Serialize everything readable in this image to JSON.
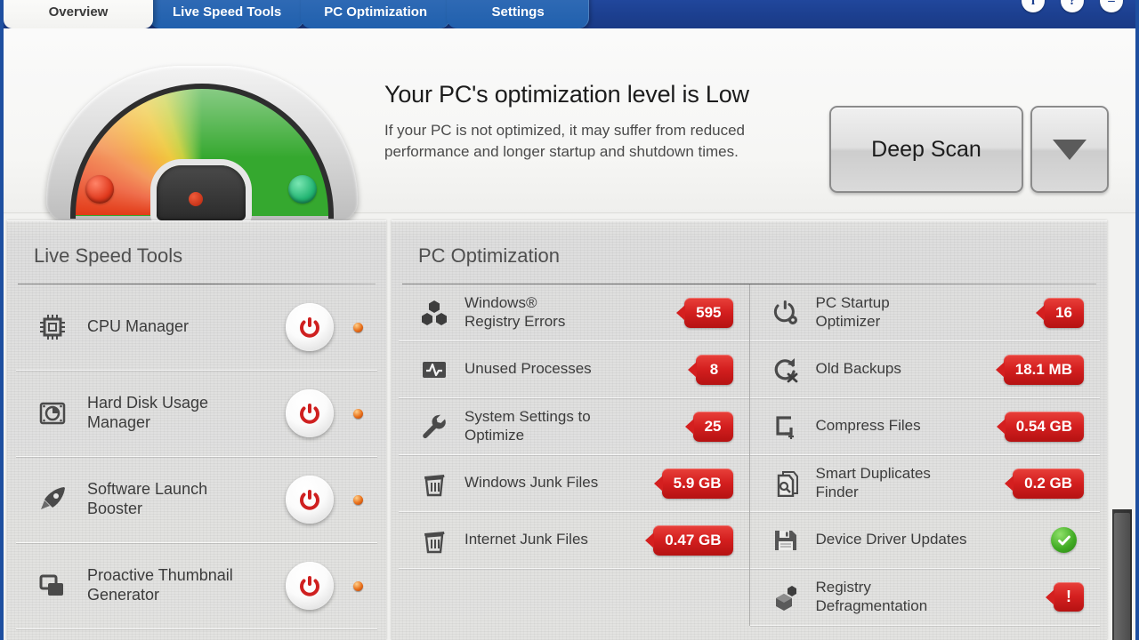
{
  "window": {
    "accent_blue": "#1e4fa0",
    "tab_blue": "#2f6ab5",
    "badge_red": "#d41f1f",
    "ok_green": "#3faa22"
  },
  "tabs": [
    {
      "label": "Overview",
      "active": true
    },
    {
      "label": "Live Speed Tools",
      "active": false
    },
    {
      "label": "PC Optimization",
      "active": false
    },
    {
      "label": "Settings",
      "active": false
    }
  ],
  "window_icons": [
    {
      "name": "info-icon",
      "glyph": "i"
    },
    {
      "name": "help-icon",
      "glyph": "?"
    },
    {
      "name": "minimize-icon",
      "glyph": "–"
    }
  ],
  "hero": {
    "title": "Your PC's optimization level is Low",
    "optimization_level": "Low",
    "description": "If your PC is not optimized, it may suffer from reduced performance and longer startup and shutdown times.",
    "scan_button": "Deep Scan",
    "scan_dropdown": "▼"
  },
  "live_speed_tools": {
    "title": "Live Speed Tools",
    "items": [
      {
        "label": "CPU Manager",
        "icon": "cpu-chip-icon",
        "state": "off"
      },
      {
        "label": "Hard Disk Usage\nManager",
        "icon": "hard-disk-icon",
        "state": "off"
      },
      {
        "label": "Software Launch\nBooster",
        "icon": "rocket-icon",
        "state": "off"
      },
      {
        "label": "Proactive Thumbnail\nGenerator",
        "icon": "windows-stack-icon",
        "state": "off"
      }
    ]
  },
  "pc_optimization": {
    "title": "PC Optimization",
    "column_left": [
      {
        "label": "Windows®\nRegistry Errors",
        "icon": "hexagons-icon",
        "value": "595",
        "status": "issue"
      },
      {
        "label": "Unused Processes",
        "icon": "activity-monitor-icon",
        "value": "8",
        "status": "issue"
      },
      {
        "label": "System Settings to\nOptimize",
        "icon": "wrench-icon",
        "value": "25",
        "status": "issue"
      },
      {
        "label": "Windows Junk Files",
        "icon": "trash-icon",
        "value": "5.9 GB",
        "status": "issue"
      },
      {
        "label": "Internet Junk Files",
        "icon": "trash-icon",
        "value": "0.47 GB",
        "status": "issue"
      }
    ],
    "column_right": [
      {
        "label": "PC Startup\nOptimizer",
        "icon": "power-gear-icon",
        "value": "16",
        "status": "issue"
      },
      {
        "label": "Old Backups",
        "icon": "backup-remove-icon",
        "value": "18.1 MB",
        "status": "issue"
      },
      {
        "label": "Compress Files",
        "icon": "compress-icon",
        "value": "0.54 GB",
        "status": "issue"
      },
      {
        "label": "Smart Duplicates\nFinder",
        "icon": "duplicate-search-icon",
        "value": "0.2 GB",
        "status": "issue"
      },
      {
        "label": "Device Driver Updates",
        "icon": "floppy-disk-icon",
        "value": "",
        "status": "ok"
      },
      {
        "label": "Registry\nDefragmentation",
        "icon": "defrag-hex-icon",
        "value": "!",
        "status": "alert"
      }
    ]
  }
}
